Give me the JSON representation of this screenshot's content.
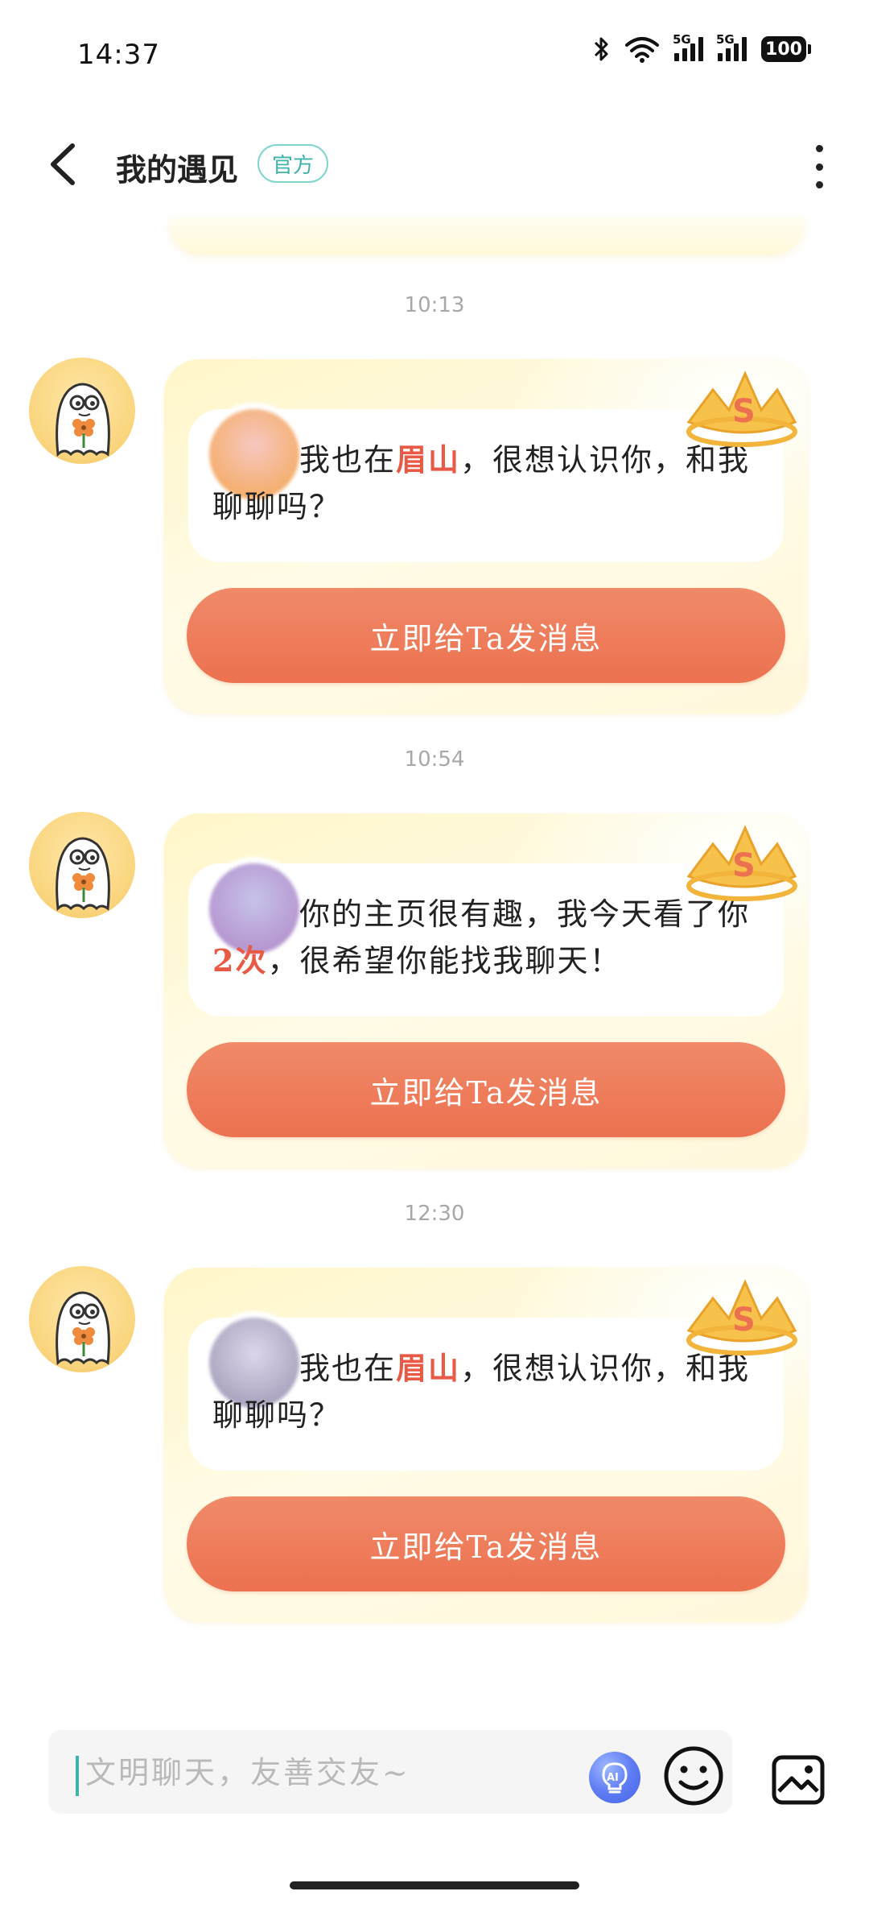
{
  "status_bar": {
    "time": "14:37",
    "network_1": "5G",
    "network_2": "5G",
    "battery": "100",
    "icons": [
      "bluetooth-icon",
      "wifi-icon",
      "signal-icon",
      "signal-icon",
      "battery-icon"
    ]
  },
  "header": {
    "title": "我的遇见",
    "badge": "官方",
    "back_icon": "chevron-left-icon",
    "more_icon": "more-vertical-icon"
  },
  "messages": [
    {
      "timestamp": "10:13",
      "text_before": "我也在",
      "highlight": "眉山",
      "text_after": "，很想认识你，和我聊聊吗？",
      "button_label": "立即给Ta发消息",
      "photo_colors": [
        "#f7c7c0",
        "#f4a95a"
      ]
    },
    {
      "timestamp": "10:54",
      "text_before": "你的主页很有趣，我今天看了你",
      "highlight": "2次",
      "text_after": "，很希望你能找我聊天！",
      "button_label": "立即给Ta发消息",
      "photo_colors": [
        "#c7c3ea",
        "#b18bc9"
      ]
    },
    {
      "timestamp": "12:30",
      "text_before": "我也在",
      "highlight": "眉山",
      "text_after": "，很想认识你，和我聊聊吗？",
      "button_label": "立即给Ta发消息",
      "photo_colors": [
        "#dcd6ea",
        "#9f98b5"
      ]
    }
  ],
  "composer": {
    "placeholder": "文明聊天，友善交友~",
    "ai_label": "AI"
  },
  "colors": {
    "accent_teal": "#3fb3aa",
    "cta_orange": "#ec7150",
    "highlight_red": "#e85a45"
  }
}
